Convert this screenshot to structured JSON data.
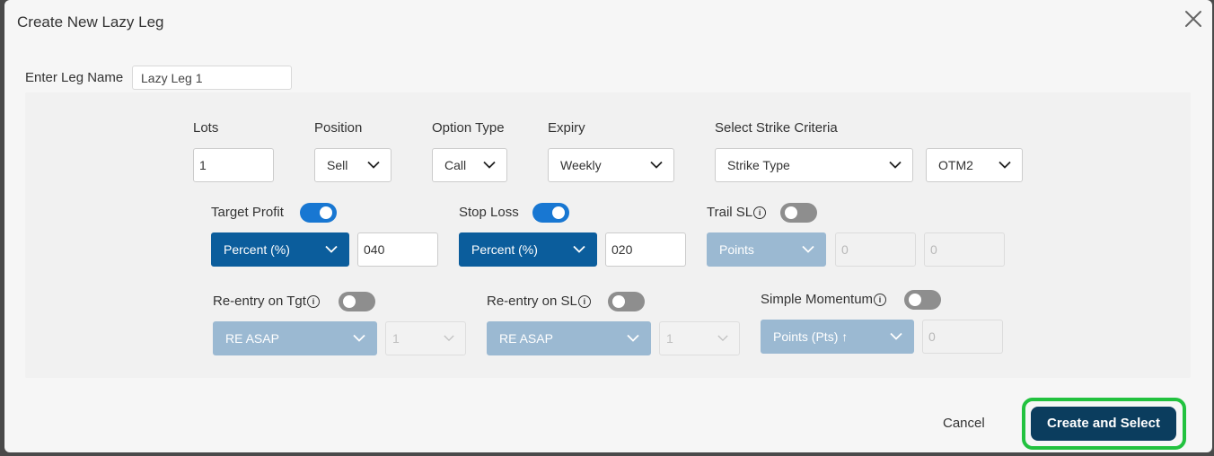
{
  "dialog": {
    "title": "Create New Lazy Leg",
    "leg_name_label": "Enter Leg Name",
    "leg_name_value": "Lazy Leg 1"
  },
  "row1": {
    "lots_label": "Lots",
    "lots_value": "1",
    "position_label": "Position",
    "position_value": "Sell",
    "option_type_label": "Option Type",
    "option_type_value": "Call",
    "expiry_label": "Expiry",
    "expiry_value": "Weekly",
    "strike_criteria_label": "Select Strike Criteria",
    "strike_type_value": "Strike Type",
    "strike_value": "OTM2"
  },
  "row2": {
    "target_profit_label": "Target Profit",
    "target_profit_enabled": true,
    "target_profit_unit": "Percent (%)",
    "target_profit_value": "040",
    "stop_loss_label": "Stop Loss",
    "stop_loss_enabled": true,
    "stop_loss_unit": "Percent (%)",
    "stop_loss_value": "020",
    "trail_sl_label": "Trail SL",
    "trail_sl_enabled": false,
    "trail_sl_unit": "Points",
    "trail_sl_value1": "0",
    "trail_sl_value2": "0"
  },
  "row3": {
    "reentry_tgt_label": "Re-entry on Tgt",
    "reentry_tgt_enabled": false,
    "reentry_tgt_mode": "RE ASAP",
    "reentry_tgt_count": "1",
    "reentry_sl_label": "Re-entry on SL",
    "reentry_sl_enabled": false,
    "reentry_sl_mode": "RE ASAP",
    "reentry_sl_count": "1",
    "momentum_label": "Simple Momentum",
    "momentum_enabled": false,
    "momentum_unit": "Points (Pts) ↑",
    "momentum_value": "0"
  },
  "footer": {
    "cancel_label": "Cancel",
    "create_label": "Create and Select"
  },
  "colors": {
    "primary": "#0b5d9c",
    "disabled_select": "#9bb9d2",
    "toggle_on": "#1877d2",
    "toggle_off": "#8e8e8e",
    "create_button": "#0b3d5e",
    "highlight": "#22c23f"
  }
}
